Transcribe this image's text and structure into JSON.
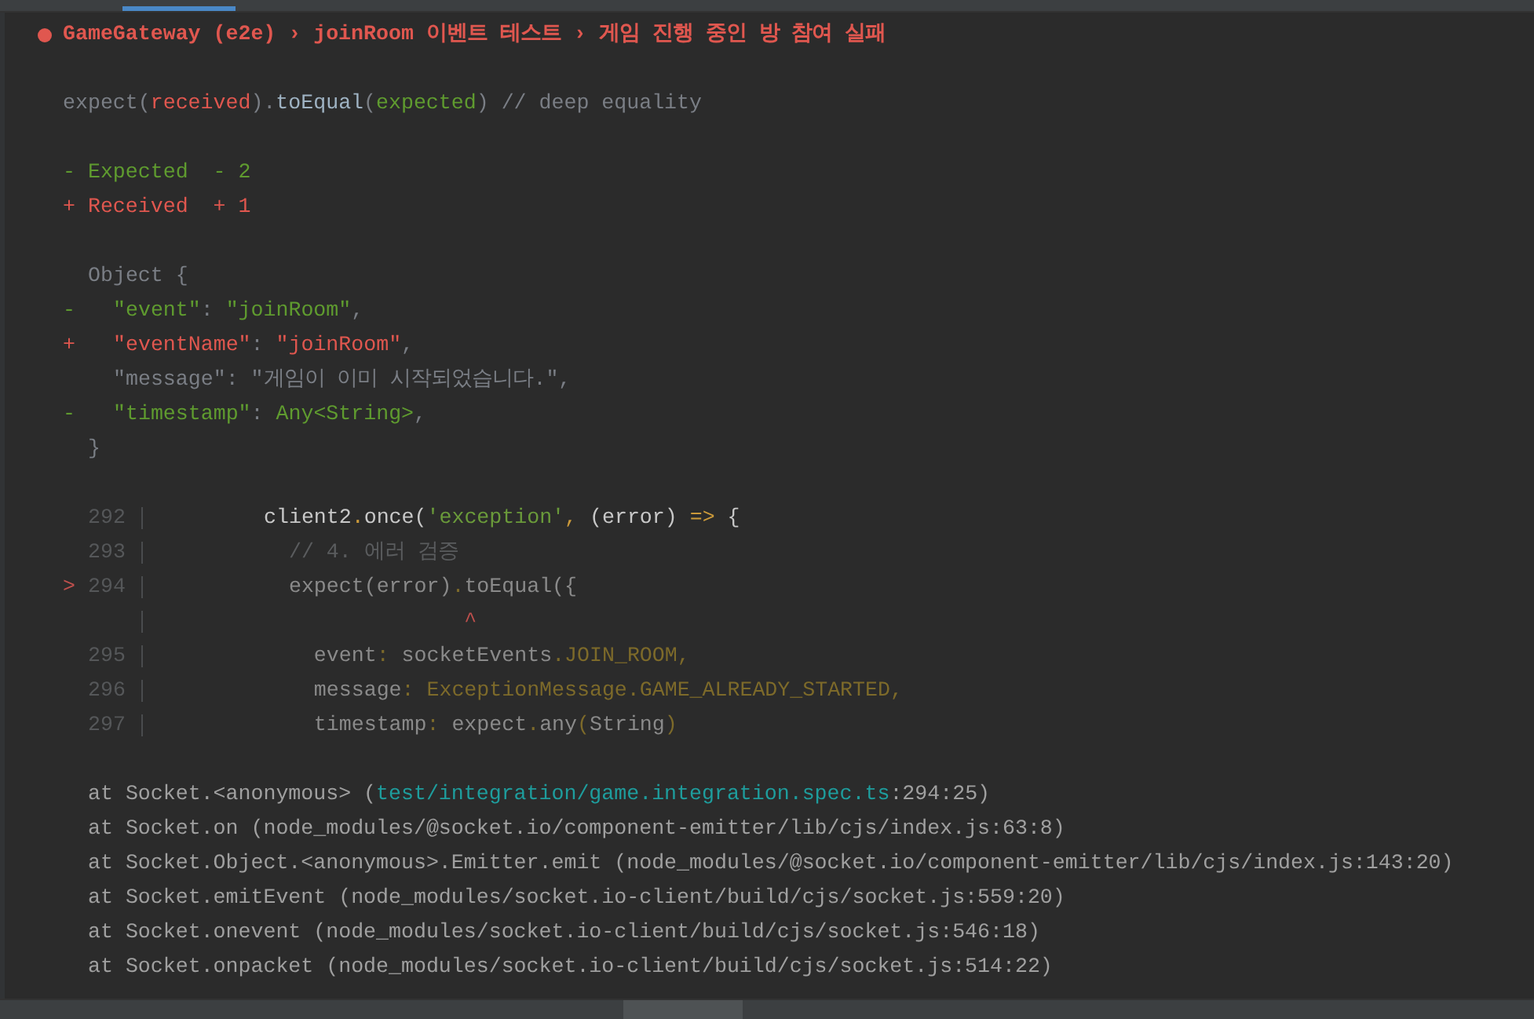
{
  "header": {
    "failed": true,
    "title": "GameGateway (e2e) › joinRoom 이벤트 테스트 › 게임 진행 중인 방 참여 실패"
  },
  "assertion": [
    {
      "kind": "muted",
      "text": "expect("
    },
    {
      "kind": "red",
      "text": "received"
    },
    {
      "kind": "muted",
      "text": ")."
    },
    {
      "kind": "method",
      "text": "toEqual"
    },
    {
      "kind": "muted",
      "text": "("
    },
    {
      "kind": "green",
      "text": "expected"
    },
    {
      "kind": "muted",
      "text": ") // deep equality"
    }
  ],
  "legend": [
    {
      "kind": "removed",
      "text": "- Expected  - 2"
    },
    {
      "kind": "added",
      "text": "+ Received  + 1"
    }
  ],
  "diff": {
    "open": "Object {",
    "close": "}",
    "lines": [
      {
        "kind": "removed",
        "marker": "-",
        "segments": [
          {
            "kind": "green",
            "text": "\"event\""
          },
          {
            "kind": "muted",
            "text": ": "
          },
          {
            "kind": "green",
            "text": "\"joinRoom\""
          },
          {
            "kind": "muted",
            "text": ","
          }
        ]
      },
      {
        "kind": "added",
        "marker": "+",
        "segments": [
          {
            "kind": "red",
            "text": "\"eventName\""
          },
          {
            "kind": "muted",
            "text": ": "
          },
          {
            "kind": "red",
            "text": "\"joinRoom\""
          },
          {
            "kind": "muted",
            "text": ","
          }
        ]
      },
      {
        "kind": "same",
        "segments": [
          {
            "kind": "muted",
            "text": "\"message\": \"게임이 이미 시작되었습니다.\","
          }
        ]
      },
      {
        "kind": "removed",
        "marker": "-",
        "segments": [
          {
            "kind": "green",
            "text": "\"timestamp\""
          },
          {
            "kind": "muted",
            "text": ": "
          },
          {
            "kind": "green",
            "text": "Any<String>"
          },
          {
            "kind": "muted",
            "text": ","
          }
        ]
      }
    ]
  },
  "code_frame": [
    {
      "number": "292",
      "segments": [
        {
          "kind": "bright",
          "text": "client2"
        },
        {
          "kind": "keyword",
          "text": "."
        },
        {
          "kind": "bright",
          "text": "once("
        },
        {
          "kind": "string",
          "text": "'exception'"
        },
        {
          "kind": "keyword",
          "text": ", "
        },
        {
          "kind": "bright",
          "text": "(error) "
        },
        {
          "kind": "keyword",
          "text": "=> "
        },
        {
          "kind": "bright",
          "text": "{"
        }
      ]
    },
    {
      "number": "293",
      "segments": [
        {
          "kind": "comment",
          "text": "  // 4. 에러 검증"
        }
      ]
    },
    {
      "number": "294",
      "marker": ">",
      "segments": [
        {
          "kind": "dim",
          "text": "  expect(error)"
        },
        {
          "kind": "dimkey",
          "text": "."
        },
        {
          "kind": "dim",
          "text": "toEqual({"
        }
      ]
    },
    {
      "segments": [
        {
          "kind": "caret",
          "text": "                ^"
        }
      ]
    },
    {
      "number": "295",
      "segments": [
        {
          "kind": "dim",
          "text": "    event"
        },
        {
          "kind": "dimkey",
          "text": ": "
        },
        {
          "kind": "dim",
          "text": "socketEvents"
        },
        {
          "kind": "dimkey",
          "text": ".JOIN_ROOM,"
        }
      ]
    },
    {
      "number": "296",
      "segments": [
        {
          "kind": "dim",
          "text": "    message"
        },
        {
          "kind": "dimkey",
          "text": ": ExceptionMessage.GAME_ALREADY_STARTED,"
        }
      ]
    },
    {
      "number": "297",
      "segments": [
        {
          "kind": "dim",
          "text": "    timestamp"
        },
        {
          "kind": "dimkey",
          "text": ": "
        },
        {
          "kind": "dim",
          "text": "expect"
        },
        {
          "kind": "dimkey",
          "text": "."
        },
        {
          "kind": "dim",
          "text": "any"
        },
        {
          "kind": "dimkey",
          "text": "("
        },
        {
          "kind": "dim",
          "text": "String"
        },
        {
          "kind": "dimkey",
          "text": ")"
        }
      ]
    }
  ],
  "stack": [
    {
      "text": "at Socket.<anonymous> (",
      "link": "test/integration/game.integration.spec.ts",
      "after": ":294:25)"
    },
    {
      "text": "at Socket.on (node_modules/@socket.io/component-emitter/lib/cjs/index.js:63:8)"
    },
    {
      "text": "at Socket.Object.<anonymous>.Emitter.emit (node_modules/@socket.io/component-emitter/lib/cjs/index.js:143:20)"
    },
    {
      "text": "at Socket.emitEvent (node_modules/socket.io-client/build/cjs/socket.js:559:20)"
    },
    {
      "text": "at Socket.onevent (node_modules/socket.io-client/build/cjs/socket.js:546:18)"
    },
    {
      "text": "at Socket.onpacket (node_modules/socket.io-client/build/cjs/socket.js:514:22)"
    }
  ]
}
